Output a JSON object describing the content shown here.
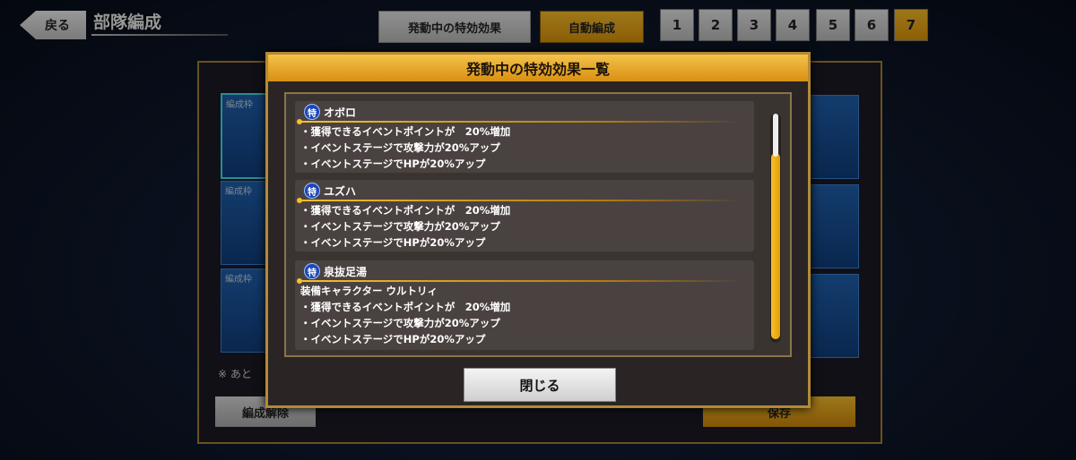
{
  "topbar": {
    "back_label": "戻る",
    "title": "部隊編成",
    "effects_button": "発動中の特効効果",
    "auto_button": "自動編成",
    "page_tabs": [
      "1",
      "2",
      "3",
      "4",
      "5",
      "6",
      "7"
    ],
    "active_tab": "7"
  },
  "background": {
    "slot_label": "編成枠",
    "note": "※ あと",
    "unform_button": "編成解除",
    "save_button": "保存"
  },
  "modal": {
    "title": "発動中の特効効果一覧",
    "badge_char": "特",
    "entries": [
      {
        "name": "オボロ",
        "effects": [
          "・獲得できるイベントポイントが　20%増加",
          "・イベントステージで攻撃力が20%アップ",
          "・イベントステージでHPが20%アップ"
        ]
      },
      {
        "name": "ユズハ",
        "effects": [
          "・獲得できるイベントポイントが　20%増加",
          "・イベントステージで攻撃力が20%アップ",
          "・イベントステージでHPが20%アップ"
        ]
      },
      {
        "name": "泉抜足湯",
        "subtitle": "装備キャラクター ウルトリィ",
        "effects": [
          "・獲得できるイベントポイントが　20%増加",
          "・イベントステージで攻撃力が20%アップ",
          "・イベントステージでHPが20%アップ"
        ]
      }
    ],
    "close_button": "閉じる"
  },
  "colors": {
    "accent_gold": "#f2b829",
    "badge_blue": "#1e48b8",
    "slot_blue": "#1e5da8"
  }
}
